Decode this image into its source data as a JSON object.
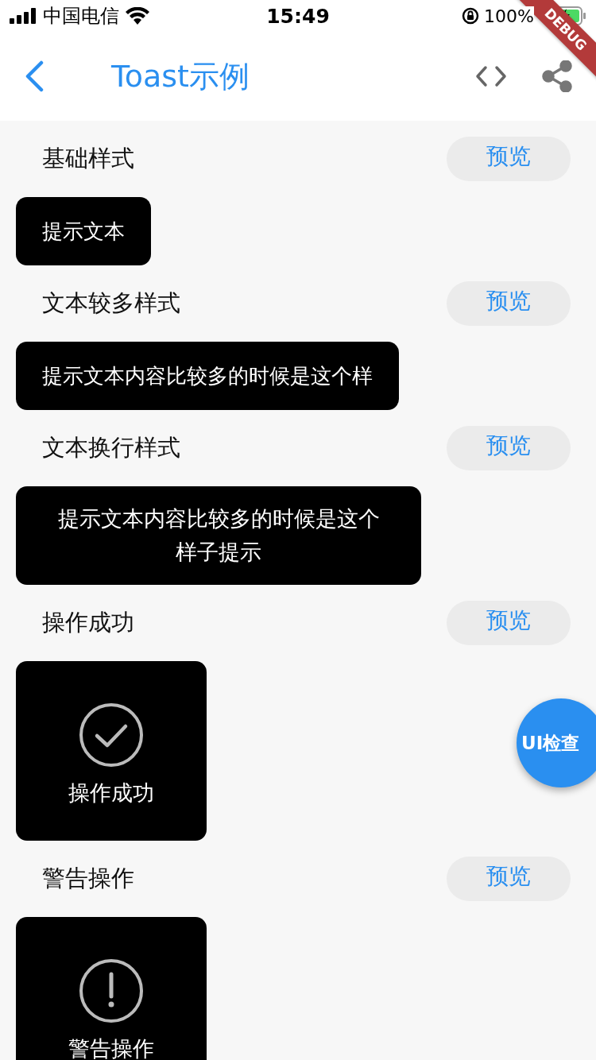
{
  "status_bar": {
    "carrier": "中国电信",
    "time": "15:49",
    "battery": "100%"
  },
  "nav": {
    "title": "Toast示例"
  },
  "sections": [
    {
      "title": "基础样式",
      "button": "预览",
      "toast": {
        "kind": "text",
        "text": "提示文本"
      }
    },
    {
      "title": "文本较多样式",
      "button": "预览",
      "toast": {
        "kind": "text",
        "text": "提示文本内容比较多的时候是这个样"
      }
    },
    {
      "title": "文本换行样式",
      "button": "预览",
      "toast": {
        "kind": "wrap",
        "text": "提示文本内容比较多的时候是这个样子提示"
      }
    },
    {
      "title": "操作成功",
      "button": "预览",
      "toast": {
        "kind": "success",
        "text": "操作成功"
      }
    },
    {
      "title": "警告操作",
      "button": "预览",
      "toast": {
        "kind": "warning",
        "text": "警告操作"
      }
    }
  ],
  "fab": {
    "label": "UI检查"
  },
  "debug_banner": {
    "label": "DEBUG"
  }
}
